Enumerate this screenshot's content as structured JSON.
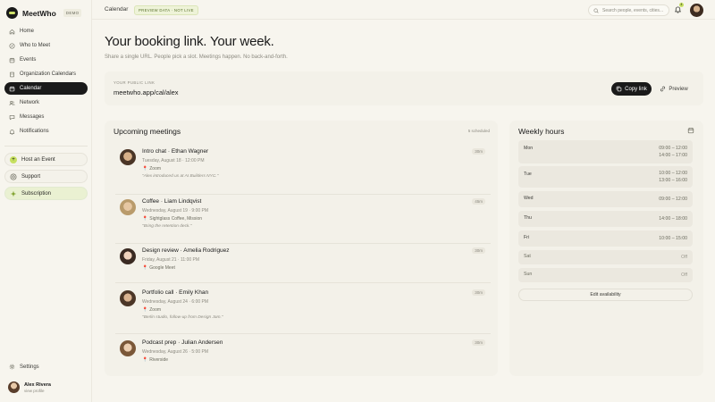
{
  "app": {
    "name": "MeetWho",
    "badge": "DEMO"
  },
  "sidebar": {
    "items": [
      {
        "label": "Home",
        "icon": "home-icon"
      },
      {
        "label": "Who to Meet",
        "icon": "compass-icon"
      },
      {
        "label": "Events",
        "icon": "calendar-icon"
      },
      {
        "label": "Organization Calendars",
        "icon": "building-icon"
      },
      {
        "label": "Calendar",
        "icon": "calendar-icon",
        "active": true
      },
      {
        "label": "Network",
        "icon": "people-icon"
      },
      {
        "label": "Messages",
        "icon": "message-icon"
      },
      {
        "label": "Notifications",
        "icon": "bell-icon"
      }
    ],
    "host_event": "Host an Event",
    "support": "Support",
    "subscription": "Subscription",
    "settings": "Settings",
    "user": {
      "name": "Alex Rivera",
      "sub": "view profile"
    }
  },
  "topbar": {
    "breadcrumb": "Calendar",
    "preview_badge": "PREVIEW DATA · NOT LIVE",
    "search_placeholder": "Search people, events, cities...",
    "notification_count": "4"
  },
  "page": {
    "title": "Your booking link. Your week.",
    "subtitle": "Share a single URL. People pick a slot. Meetings happen. No back-and-forth."
  },
  "booking_link": {
    "label": "YOUR PUBLIC LINK",
    "url": "meetwho.app/cal/alex",
    "copy_label": "Copy link",
    "preview_label": "Preview"
  },
  "upcoming": {
    "title": "Upcoming meetings",
    "count": "5 scheduled",
    "meetings": [
      {
        "title": "Intro chat · Ethan Wagner",
        "datetime": "Tuesday, August 18 · 12:00 PM",
        "location": "Zoom",
        "note": "\"Alex introduced us at AI Builders NYC.\"",
        "duration": "30m",
        "location_icon": "pin-icon"
      },
      {
        "title": "Coffee · Liam Lindqvist",
        "datetime": "Wednesday, August 19 · 9:00 PM",
        "location": "Sightglass Coffee, Mission",
        "note": "\"Bring the retention deck.\"",
        "duration": "45m",
        "location_icon": "pin-icon"
      },
      {
        "title": "Design review · Amelia Rodriguez",
        "datetime": "Friday, August 21 · 11:00 PM",
        "location": "Google Meet",
        "note": "",
        "duration": "30m",
        "location_icon": "pin-icon"
      },
      {
        "title": "Portfolio call · Emily Khan",
        "datetime": "Wednesday, August 24 · 6:00 PM",
        "location": "Zoom",
        "note": "\"Berlin studio, follow-up from Design Jam.\"",
        "duration": "30m",
        "location_icon": "pin-icon"
      },
      {
        "title": "Podcast prep · Julian Andersen",
        "datetime": "Wednesday, August 26 · 5:00 PM",
        "location": "Riverside",
        "note": "",
        "duration": "30m",
        "location_icon": "pin-icon"
      }
    ]
  },
  "weekly": {
    "title": "Weekly hours",
    "days": [
      {
        "name": "Mon",
        "times": [
          "09:00 – 12:00",
          "14:00 – 17:00"
        ]
      },
      {
        "name": "Tue",
        "times": [
          "10:00 – 12:00",
          "13:00 – 16:00"
        ]
      },
      {
        "name": "Wed",
        "times": [
          "09:00 – 12:00"
        ]
      },
      {
        "name": "Thu",
        "times": [
          "14:00 – 18:00"
        ]
      },
      {
        "name": "Fri",
        "times": [
          "10:00 – 15:00"
        ]
      },
      {
        "name": "Sat",
        "times": [
          "Off"
        ],
        "off": true
      },
      {
        "name": "Sun",
        "times": [
          "Off"
        ],
        "off": true
      }
    ],
    "edit_label": "Edit availability"
  }
}
